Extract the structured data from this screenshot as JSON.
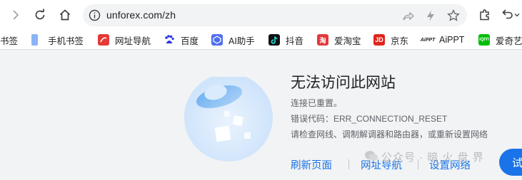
{
  "browser": {
    "url": "unforex.com/zh",
    "nav_icons": [
      "forward-icon",
      "reload-icon",
      "home-icon"
    ],
    "omnibox_icons": [
      "site-info-icon",
      "share-icon",
      "performance-icon",
      "bookmark-star-icon"
    ],
    "right_icons": [
      "extensions-icon",
      "undo-icon",
      "chevron-down-icon"
    ]
  },
  "bookmarks": {
    "items": [
      {
        "label": "书签",
        "icon": "bookmark-folder-icon"
      },
      {
        "label": "手机书签",
        "icon": "mobile-bookmarks-icon"
      },
      {
        "label": "网址导航",
        "icon": "site-nav-icon",
        "color": "#e53935"
      },
      {
        "label": "百度",
        "icon": "baidu-icon",
        "color": "#2932e1"
      },
      {
        "label": "AI助手",
        "icon": "ai-assistant-icon",
        "color": "#4e6ef2"
      },
      {
        "label": "抖音",
        "icon": "douyin-icon",
        "color": "#111111"
      },
      {
        "label": "爱淘宝",
        "icon": "taobao-icon",
        "color": "#e4393c"
      },
      {
        "label": "京东",
        "icon": "jd-icon",
        "color": "#e1251b"
      },
      {
        "label": "AiPPT",
        "icon": "aippt-icon",
        "color": "#222222"
      },
      {
        "label": "爱奇艺",
        "icon": "iqiyi-icon",
        "color": "#00be06"
      }
    ]
  },
  "error": {
    "title": "无法访问此网站",
    "line1": "连接已重置。",
    "line2": "错误代码：ERR_CONNECTION_RESET",
    "line3": "请检查网线、调制解调器和路由器，或重新设置网络",
    "links": [
      "刷新页面",
      "网址导航",
      "设置网络"
    ]
  },
  "overlay": {
    "watermark": "公众号 · 暗 火 盘 界",
    "button_label": "试"
  },
  "colors": {
    "link": "#1a73e8",
    "page_bg": "#f1f3f4",
    "illustration": "#8fc1f3"
  }
}
